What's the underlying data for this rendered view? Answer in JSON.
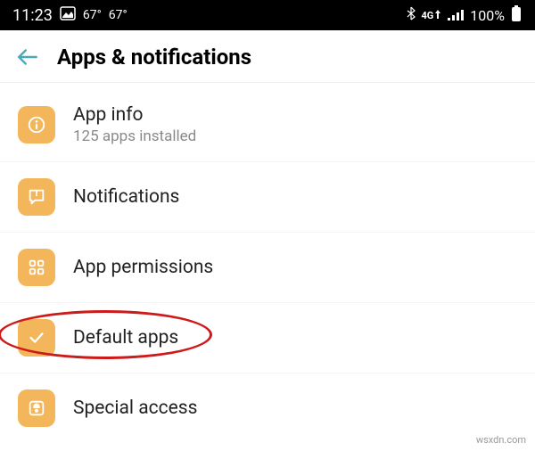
{
  "statusbar": {
    "time": "11:23",
    "temp1": "67°",
    "temp2": "67°",
    "network_label": "4G",
    "battery_percent": "100%"
  },
  "header": {
    "title": "Apps & notifications"
  },
  "items": [
    {
      "label": "App info",
      "sub": "125 apps installed"
    },
    {
      "label": "Notifications",
      "sub": ""
    },
    {
      "label": "App permissions",
      "sub": ""
    },
    {
      "label": "Default apps",
      "sub": ""
    },
    {
      "label": "Special access",
      "sub": ""
    }
  ],
  "watermark": "wsxdn.com"
}
